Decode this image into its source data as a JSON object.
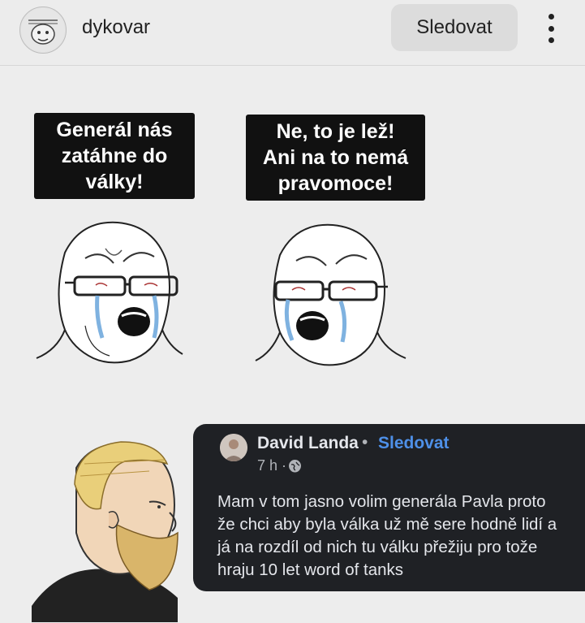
{
  "header": {
    "username": "dykovar",
    "follow_label": "Sledovat",
    "more_icon": "more-vertical-icon"
  },
  "meme": {
    "bubble_left": [
      "Generál nás",
      "zatáhne do",
      "války!"
    ],
    "bubble_right": [
      "Ne, to je lež!",
      "Ani na to nemá",
      "pravomoce!"
    ]
  },
  "facebook_comment": {
    "author": "David Landa",
    "separator": "•",
    "follow_label": "Sledovat",
    "time": "7 h ·",
    "privacy_icon": "globe-icon",
    "text_lines": [
      "Mam v tom jasno volim generála Pavla proto",
      "že chci aby byla válka už mě sere hodně lidí a",
      "já na rozdíl od nich tu válku přežiju pro tože",
      "hraju 10 let word of tanks"
    ]
  },
  "colors": {
    "background": "#ececec",
    "card_background": "#1f2125",
    "link_blue": "#4e90e8",
    "tear_blue": "#7fb2e0",
    "beard": "#d9b56a"
  }
}
